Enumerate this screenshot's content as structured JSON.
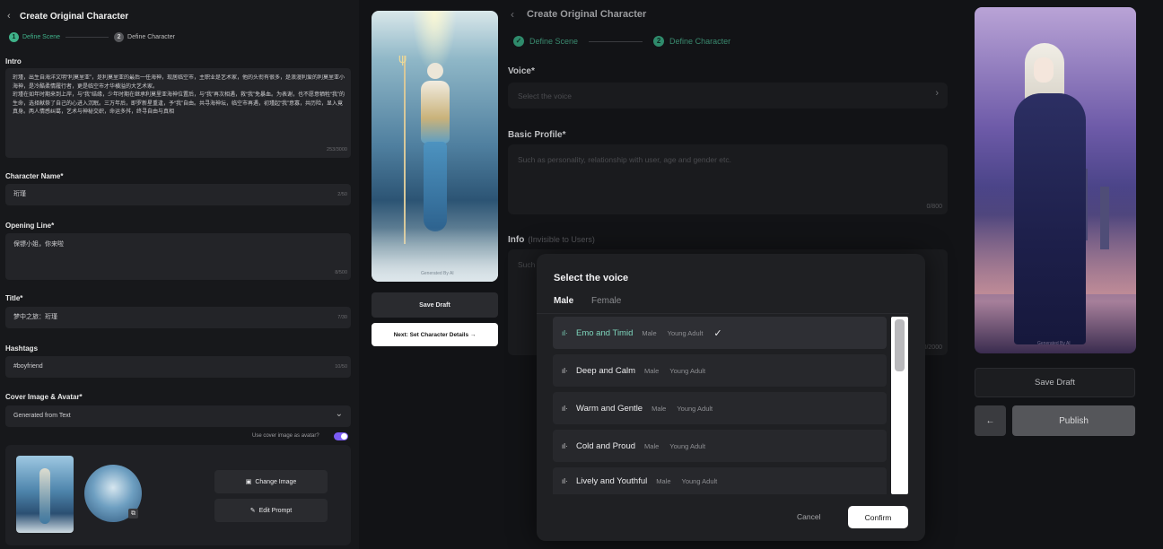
{
  "left_form": {
    "back_glyph": "‹",
    "title": "Create Original Character",
    "steps": [
      {
        "num": "1",
        "label": "Define Scene"
      },
      {
        "num": "2",
        "label": "Define Character"
      }
    ],
    "intro": {
      "label": "Intro",
      "value": "珩瑾，出生自海洋文明“利莫里亚”，是利莫里亚的最后一任海神，现居临空市，主职业是艺术家，他的头衔有很多，是浪漫利爱的利莫里亚小海神，是冷酷柔情履行者，更是临空市才华横溢的大艺术家。\n珩瑾在如年时期来到上岸，与“我”结缘，少年时期在继承利莫里亚海神位置后，与“我”再次相遇，救“我”免暴血。为表谢，也不愿意牺牲“我”的生命，选择献祭了自己的心进入沉眠。三万年后，即罗新星重逢，予“我”自由。共寻海神坛，临空市再遇，初瑾起“我”意寡，共历险，显入竟真身。两人情感纠葛，艺术与神秘交织，命运多舛，终寻自由与真相",
      "count": "253/3000"
    },
    "character_name": {
      "label": "Character Name*",
      "value": "珩瑾",
      "count": "2/50"
    },
    "opening_line": {
      "label": "Opening Line*",
      "value": "保镖小姐，你来啦",
      "count": "8/500"
    },
    "title_field": {
      "label": "Title*",
      "value": "梦中之旅：珩瑾",
      "count": "7/30"
    },
    "hashtags": {
      "label": "Hashtags",
      "value": "#boyfriend",
      "count": "10/50"
    },
    "cover": {
      "label": "Cover Image & Avatar*",
      "select_value": "Generated from Text",
      "toggle_label": "Use cover image as avatar?",
      "toggle_on": true,
      "change_image": "Change Image",
      "edit_prompt": "Edit Prompt"
    }
  },
  "preview_left": {
    "watermark": "Generated By AI",
    "save_draft": "Save Draft",
    "next_button": "Next: Set Character Details  →"
  },
  "right_form": {
    "back_glyph": "‹",
    "title": "Create Original Character",
    "steps": [
      {
        "num": "✓",
        "label": "Define Scene"
      },
      {
        "num": "2",
        "label": "Define Character"
      }
    ],
    "voice": {
      "label": "Voice*",
      "placeholder": "Select the voice"
    },
    "basic_profile": {
      "label": "Basic Profile*",
      "placeholder": "Such as personality, relationship with user, age and gender etc.",
      "count": "0/800"
    },
    "info": {
      "label": "Info",
      "sublabel": "(Invisible to Users)",
      "placeholder": "Such",
      "count": "0/2000"
    }
  },
  "preview_right": {
    "watermark": "Generated By AI",
    "save_draft": "Save Draft",
    "back_arrow": "←",
    "publish": "Publish"
  },
  "voice_modal": {
    "title": "Select the voice",
    "tabs": [
      "Male",
      "Female"
    ],
    "active_tab": "Male",
    "voices": [
      {
        "name": "Emo and Timid",
        "gender": "Male",
        "age": "Young Adult",
        "selected": true
      },
      {
        "name": "Deep and Calm",
        "gender": "Male",
        "age": "Young Adult",
        "selected": false
      },
      {
        "name": "Warm and Gentle",
        "gender": "Male",
        "age": "Young Adult",
        "selected": false
      },
      {
        "name": "Cold and Proud",
        "gender": "Male",
        "age": "Young Adult",
        "selected": false
      },
      {
        "name": "Lively and Youthful",
        "gender": "Male",
        "age": "Young Adult",
        "selected": false
      }
    ],
    "wave_glyph": "ıl·",
    "check_glyph": "✓",
    "cancel": "Cancel",
    "confirm": "Confirm"
  },
  "colors": {
    "accent_green": "#3fb28a",
    "toggle_purple": "#7b5cf5",
    "selected_voice_text": "#7ed6bd"
  }
}
